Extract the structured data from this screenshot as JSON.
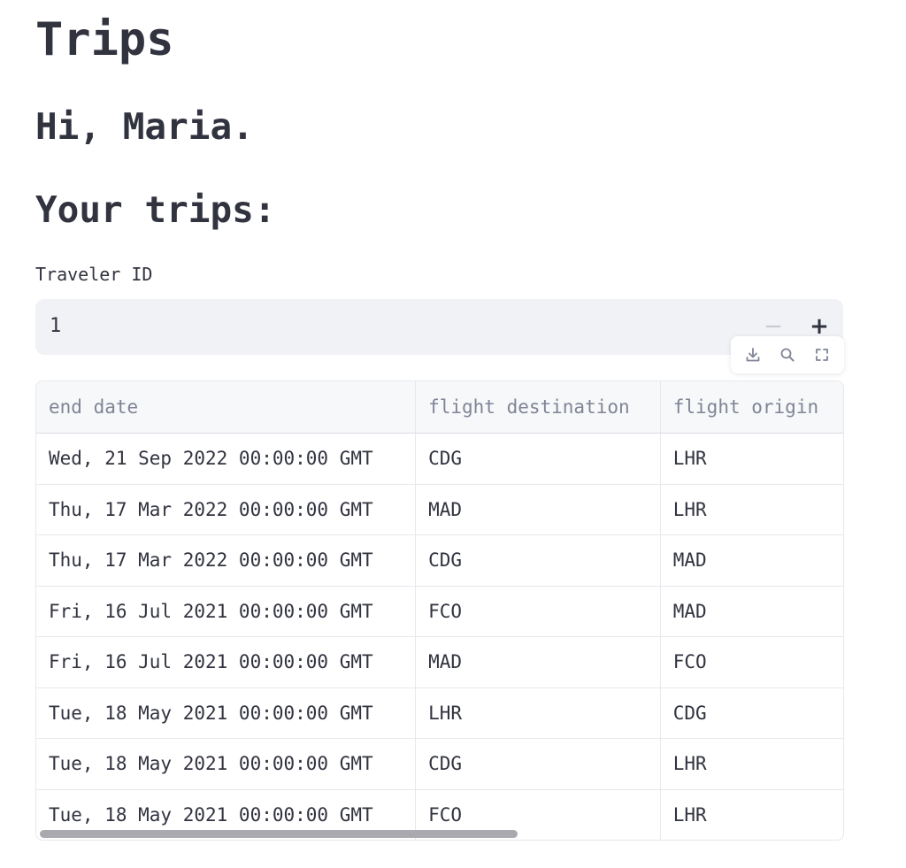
{
  "page": {
    "title": "Trips",
    "greeting": "Hi, Maria.",
    "section_heading": "Your trips:"
  },
  "traveler_input": {
    "label": "Traveler ID",
    "value": "1",
    "decrement_label": "−",
    "increment_label": "+"
  },
  "toolbar": {
    "icons": [
      "download-icon",
      "search-icon",
      "fullscreen-icon"
    ]
  },
  "table": {
    "columns": [
      "end date",
      "flight destination",
      "flight origin"
    ],
    "rows": [
      [
        "Wed, 21 Sep 2022 00:00:00 GMT",
        "CDG",
        "LHR"
      ],
      [
        "Thu, 17 Mar 2022 00:00:00 GMT",
        "MAD",
        "LHR"
      ],
      [
        "Thu, 17 Mar 2022 00:00:00 GMT",
        "CDG",
        "MAD"
      ],
      [
        "Fri, 16 Jul 2021 00:00:00 GMT",
        "FCO",
        "MAD"
      ],
      [
        "Fri, 16 Jul 2021 00:00:00 GMT",
        "MAD",
        "FCO"
      ],
      [
        "Tue, 18 May 2021 00:00:00 GMT",
        "LHR",
        "CDG"
      ],
      [
        "Tue, 18 May 2021 00:00:00 GMT",
        "CDG",
        "LHR"
      ],
      [
        "Tue, 18 May 2021 00:00:00 GMT",
        "FCO",
        "LHR"
      ]
    ]
  },
  "colors": {
    "text": "#31333f",
    "input_background": "#f0f2f6",
    "header_text": "#808495",
    "border": "#e6e8ec"
  }
}
